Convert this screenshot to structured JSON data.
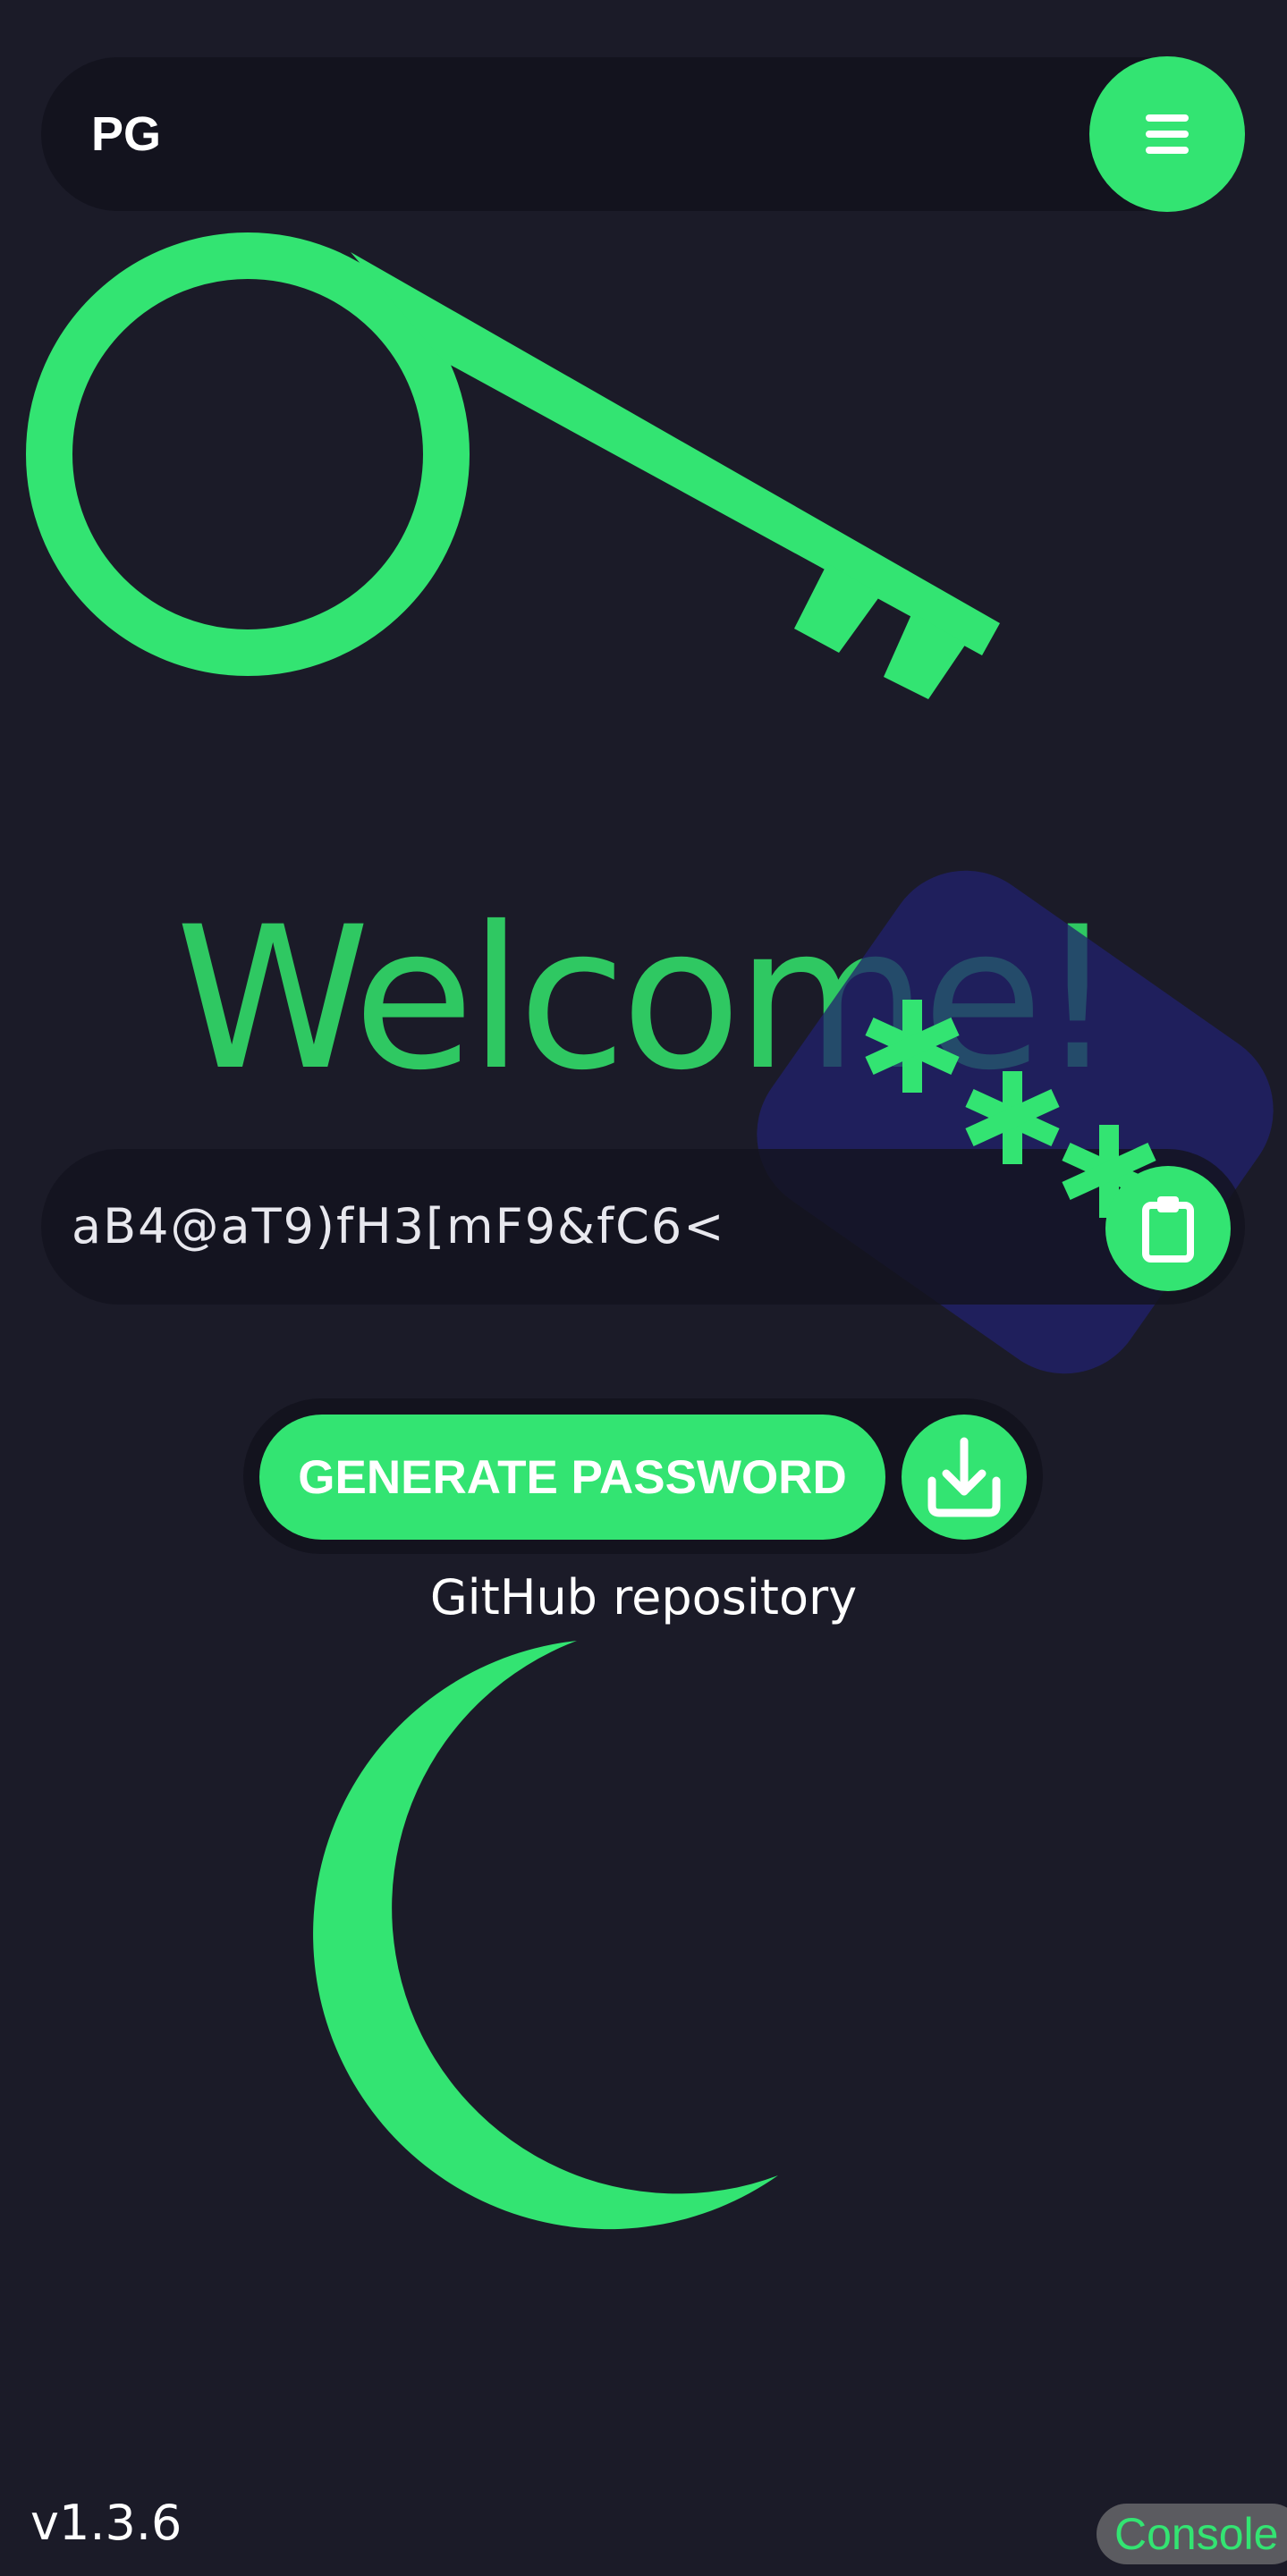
{
  "header": {
    "logo_text": "PG",
    "menu_icon": "hamburger-menu-icon"
  },
  "hero": {
    "title": "Welcome!",
    "illustration": "key-icon",
    "decoration": "asterisks-icon"
  },
  "password": {
    "value": "aB4@aT9)fH3[mF9&fC6<",
    "copy_icon": "clipboard-icon"
  },
  "actions": {
    "generate_label": "GENERATE PASSWORD",
    "download_icon": "download-icon"
  },
  "links": {
    "github_label": "GitHub repository"
  },
  "theme": {
    "toggle_icon": "moon-icon"
  },
  "footer": {
    "version": "v1.3.6",
    "console_label": "Console"
  },
  "colors": {
    "background": "#1b1b28",
    "accent": "#33e472",
    "title": "#2fc862",
    "panel": "#13131e"
  }
}
